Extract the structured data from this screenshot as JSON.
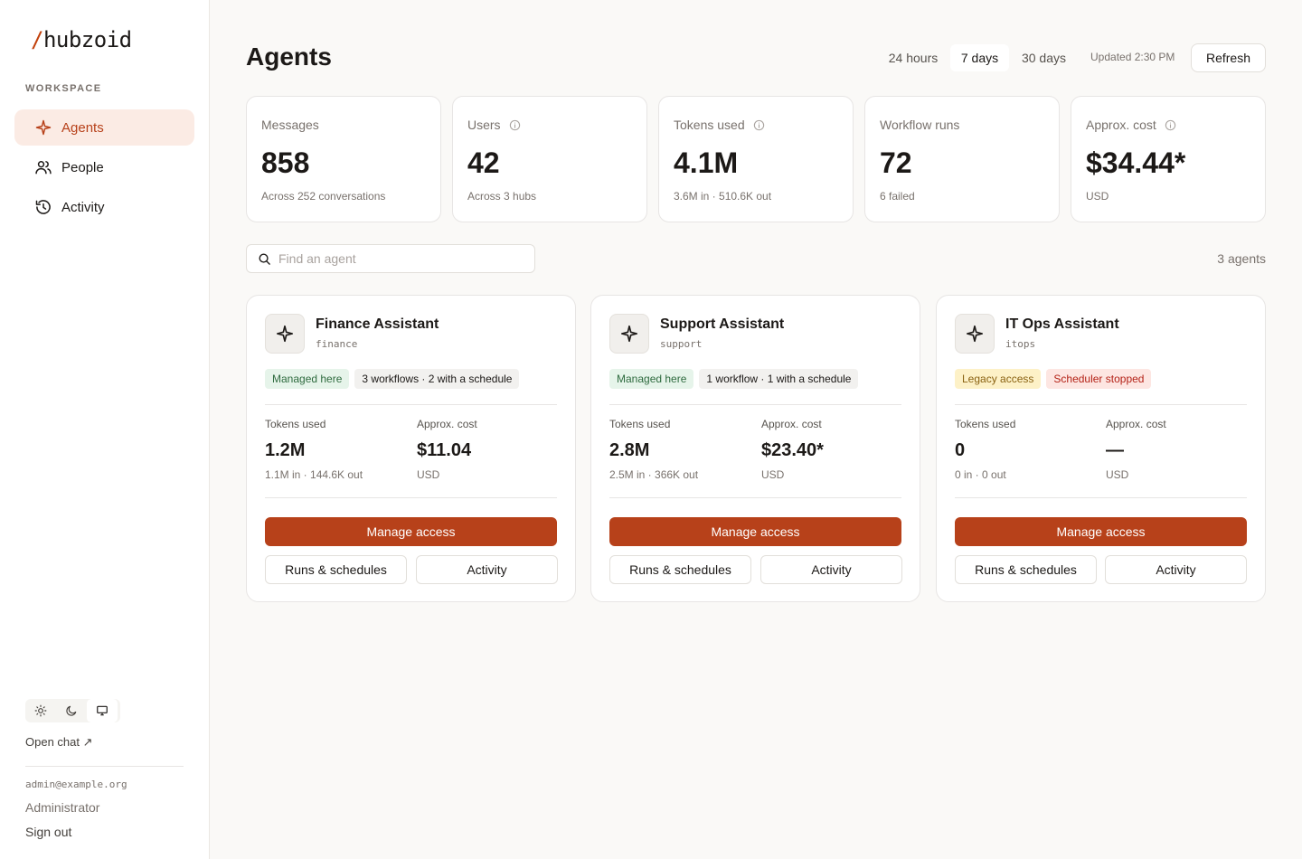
{
  "brand": {
    "slash": "/",
    "name": "hubzoid"
  },
  "sidebar": {
    "section_label": "WORKSPACE",
    "items": [
      {
        "label": "Agents",
        "icon": "sparkle-icon",
        "active": true
      },
      {
        "label": "People",
        "icon": "users-icon",
        "active": false
      },
      {
        "label": "Activity",
        "icon": "history-icon",
        "active": false
      }
    ],
    "theme": {
      "options": [
        "sun-icon",
        "moon-icon",
        "monitor-icon"
      ],
      "selected": "monitor-icon"
    },
    "open_chat": "Open chat ↗",
    "user": {
      "email": "admin@example.org",
      "role": "Administrator",
      "sign_out": "Sign out"
    }
  },
  "header": {
    "title": "Agents",
    "ranges": [
      "24 hours",
      "7 days",
      "30 days"
    ],
    "selected_range": "7 days",
    "updated": "Updated 2:30 PM",
    "refresh_label": "Refresh"
  },
  "stats": [
    {
      "label": "Messages",
      "value": "858",
      "sub": "Across 252 conversations",
      "info": false
    },
    {
      "label": "Users",
      "value": "42",
      "sub": "Across 3 hubs",
      "info": true
    },
    {
      "label": "Tokens used",
      "value": "4.1M",
      "sub": "3.6M in · 510.6K out",
      "info": true
    },
    {
      "label": "Workflow runs",
      "value": "72",
      "sub": "6 failed",
      "info": false
    },
    {
      "label": "Approx. cost",
      "value": "$34.44*",
      "sub": "USD",
      "info": true
    }
  ],
  "search": {
    "placeholder": "Find an agent",
    "value": ""
  },
  "agent_count": "3 agents",
  "agents": [
    {
      "name": "Finance Assistant",
      "slug": "finance",
      "badges": [
        {
          "text": "Managed here",
          "tone": "green"
        },
        {
          "text": "3 workflows · 2 with a schedule",
          "tone": "gray"
        }
      ],
      "tokens_label": "Tokens used",
      "tokens": "1.2M",
      "tokens_sub": "1.1M in · 144.6K out",
      "cost_label": "Approx. cost",
      "cost": "$11.04",
      "cost_sub": "USD",
      "manage_label": "Manage access",
      "runs_label": "Runs & schedules",
      "activity_label": "Activity"
    },
    {
      "name": "Support Assistant",
      "slug": "support",
      "badges": [
        {
          "text": "Managed here",
          "tone": "green"
        },
        {
          "text": "1 workflow · 1 with a schedule",
          "tone": "gray"
        }
      ],
      "tokens_label": "Tokens used",
      "tokens": "2.8M",
      "tokens_sub": "2.5M in · 366K out",
      "cost_label": "Approx. cost",
      "cost": "$23.40*",
      "cost_sub": "USD",
      "manage_label": "Manage access",
      "runs_label": "Runs & schedules",
      "activity_label": "Activity"
    },
    {
      "name": "IT Ops Assistant",
      "slug": "itops",
      "badges": [
        {
          "text": "Legacy access",
          "tone": "yellow"
        },
        {
          "text": "Scheduler stopped",
          "tone": "red"
        }
      ],
      "tokens_label": "Tokens used",
      "tokens": "0",
      "tokens_sub": "0 in · 0 out",
      "cost_label": "Approx. cost",
      "cost": "—",
      "cost_sub": "USD",
      "manage_label": "Manage access",
      "runs_label": "Runs & schedules",
      "activity_label": "Activity"
    }
  ],
  "colors": {
    "accent": "#b7411a",
    "accent_soft": "#fbebe4",
    "background": "#faf9f7"
  }
}
